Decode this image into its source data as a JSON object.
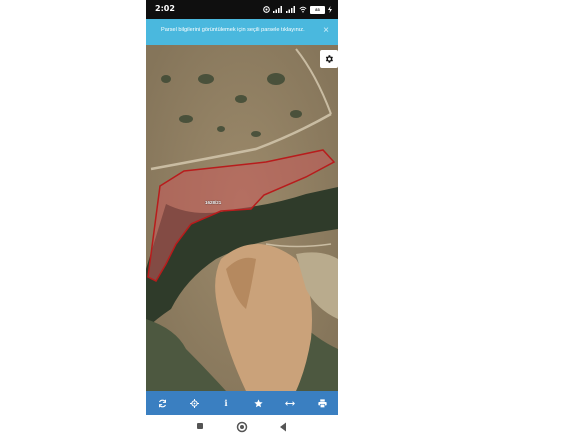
{
  "status_bar": {
    "time": "2:02",
    "battery": "83"
  },
  "banner": {
    "message": "Parsel bilgilerini görüntülemek için seçili parsele tıklayınız.",
    "close_symbol": "×"
  },
  "map": {
    "parcel_label": "1628/21"
  },
  "toolbar": {
    "buttons": [
      {
        "icon": "refresh-icon"
      },
      {
        "icon": "locate-icon"
      },
      {
        "icon": "info-icon",
        "symbol": "i"
      },
      {
        "icon": "star-icon"
      },
      {
        "icon": "measure-icon"
      },
      {
        "icon": "print-icon"
      }
    ],
    "color": "#3a7fc1"
  },
  "colors": {
    "banner": "#4ab8de",
    "parcel_fill": "#c85a5a",
    "parcel_stroke": "#b81c1c"
  }
}
